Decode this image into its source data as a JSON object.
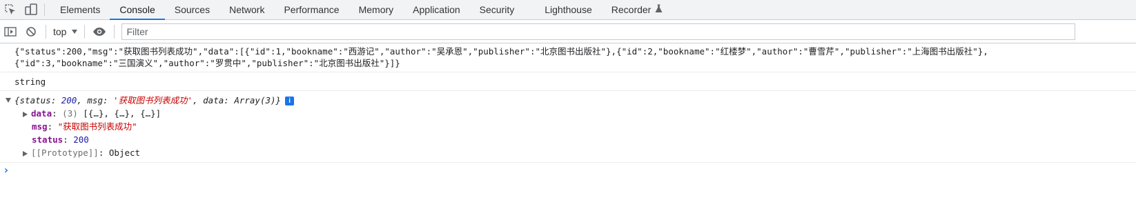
{
  "tabs": [
    {
      "label": "Elements",
      "active": false
    },
    {
      "label": "Console",
      "active": true
    },
    {
      "label": "Sources",
      "active": false
    },
    {
      "label": "Network",
      "active": false
    },
    {
      "label": "Performance",
      "active": false
    },
    {
      "label": "Memory",
      "active": false
    },
    {
      "label": "Application",
      "active": false
    },
    {
      "label": "Security",
      "active": false
    },
    {
      "label": "Lighthouse",
      "active": false
    },
    {
      "label": "Recorder",
      "active": false
    }
  ],
  "icons": {
    "inspect": "inspect-element-icon",
    "device": "device-toolbar-icon",
    "sidebar": "console-sidebar-icon",
    "clear": "clear-console-icon",
    "eye": "live-expression-eye-icon",
    "recorder": "flask-icon"
  },
  "toolbar": {
    "context": "top",
    "filter_placeholder": "Filter"
  },
  "console": {
    "json_line1": "{\"status\":200,\"msg\":\"获取图书列表成功\",\"data\":[{\"id\":1,\"bookname\":\"西游记\",\"author\":\"吴承恩\",\"publisher\":\"北京图书出版社\"},{\"id\":2,\"bookname\":\"红楼梦\",\"author\":\"曹雪芹\",\"publisher\":\"上海图书出版社\"},",
    "json_line2": "{\"id\":3,\"bookname\":\"三国演义\",\"author\":\"罗贯中\",\"publisher\":\"北京图书出版社\"}]}",
    "type_output": "string",
    "object": {
      "preview": {
        "status_key": "status",
        "status_value": "200",
        "msg_key": "msg",
        "msg_value": "'获取图书列表成功'",
        "data_key": "data",
        "data_value": "Array(3)"
      },
      "info_badge": "i",
      "props": {
        "data_key": "data",
        "data_count": "(3)",
        "data_preview": "[{…}, {…}, {…}]",
        "msg_key": "msg",
        "msg_value": "\"获取图书列表成功\"",
        "status_key": "status",
        "status_value": "200",
        "proto_key": "[[Prototype]]",
        "proto_value": "Object"
      }
    },
    "prompt_symbol": "›"
  },
  "colors": {
    "accent": "#1a73e8",
    "string": "#c80000",
    "number": "#1a1aa6",
    "key": "#881391"
  }
}
